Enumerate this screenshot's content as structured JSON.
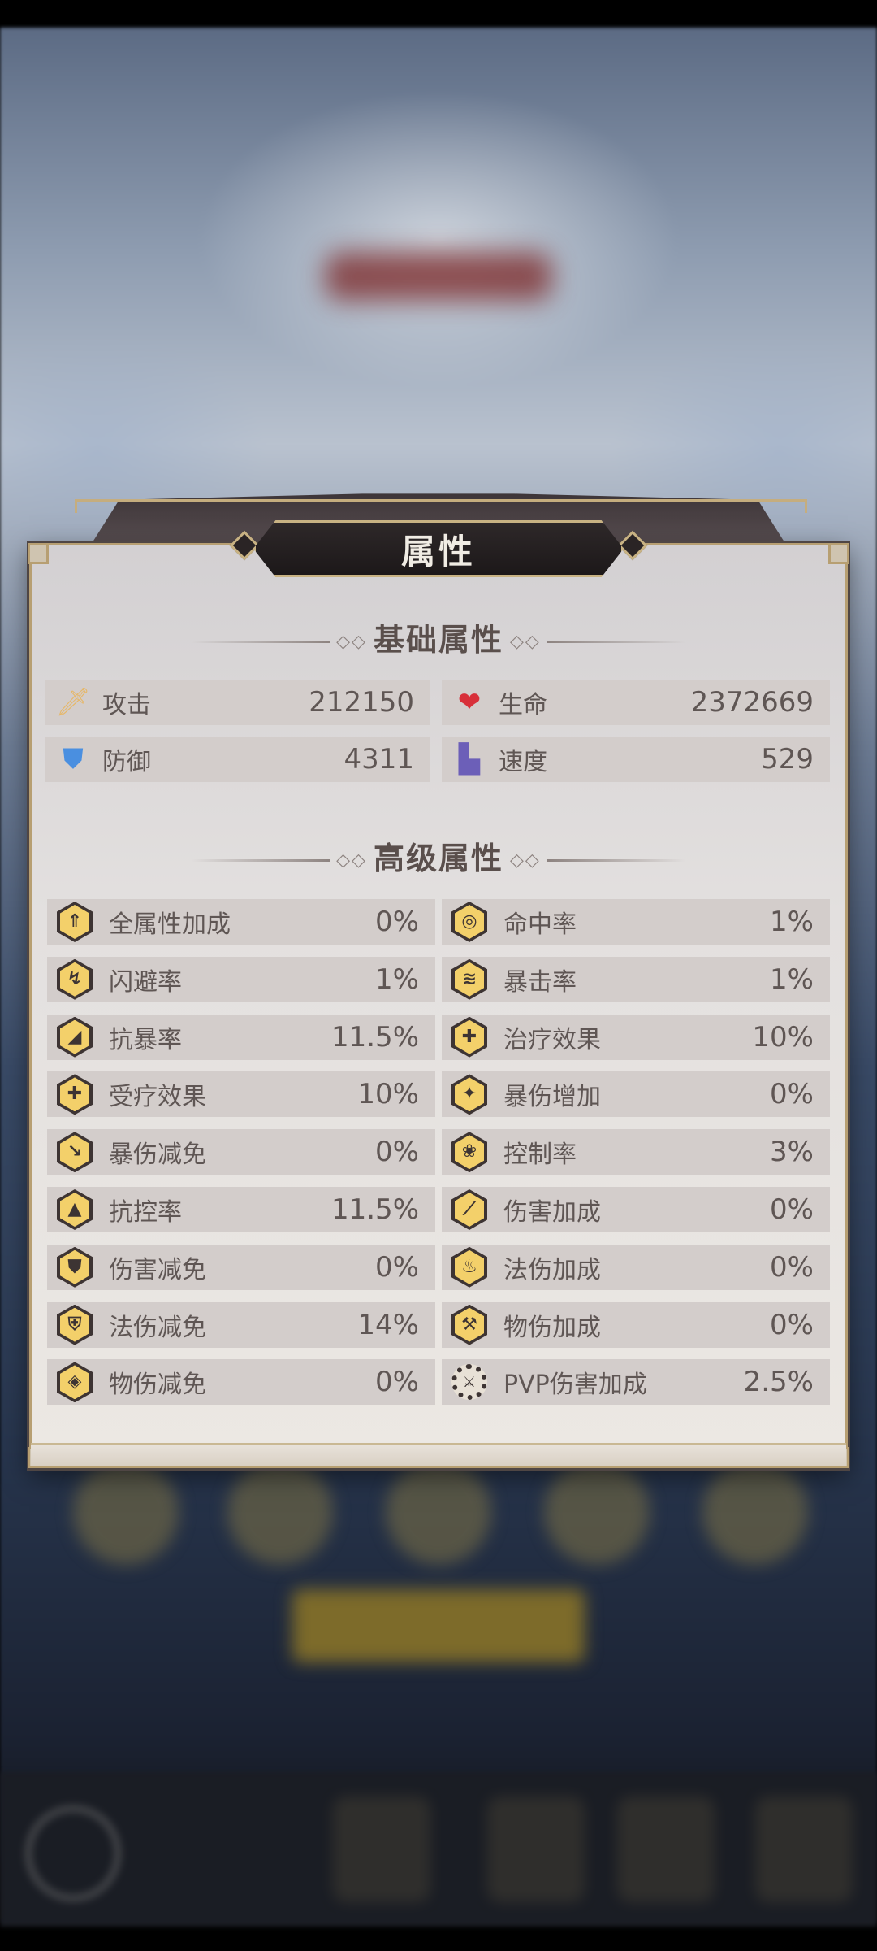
{
  "panel": {
    "title": "属性",
    "basic_section": "基础属性",
    "advanced_section": "高级属性"
  },
  "basic_stats": [
    {
      "label": "攻击",
      "value": "212150",
      "icon": "sword-icon"
    },
    {
      "label": "生命",
      "value": "2372669",
      "icon": "heart-icon"
    },
    {
      "label": "防御",
      "value": "4311",
      "icon": "shield-icon"
    },
    {
      "label": "速度",
      "value": "529",
      "icon": "boot-icon"
    }
  ],
  "advanced_stats": [
    {
      "label": "全属性加成",
      "value": "0%",
      "icon": "all-attributes-icon"
    },
    {
      "label": "命中率",
      "value": "1%",
      "icon": "target-icon"
    },
    {
      "label": "闪避率",
      "value": "1%",
      "icon": "dodge-icon"
    },
    {
      "label": "暴击率",
      "value": "1%",
      "icon": "claw-icon"
    },
    {
      "label": "抗暴率",
      "value": "11.5%",
      "icon": "crit-resist-icon"
    },
    {
      "label": "治疗效果",
      "value": "10%",
      "icon": "cross-icon"
    },
    {
      "label": "受疗效果",
      "value": "10%",
      "icon": "heal-received-icon"
    },
    {
      "label": "暴伤增加",
      "value": "0%",
      "icon": "crit-damage-icon"
    },
    {
      "label": "暴伤减免",
      "value": "0%",
      "icon": "crit-damage-reduction-icon"
    },
    {
      "label": "控制率",
      "value": "3%",
      "icon": "control-icon"
    },
    {
      "label": "抗控率",
      "value": "11.5%",
      "icon": "control-resist-icon"
    },
    {
      "label": "伤害加成",
      "value": "0%",
      "icon": "damage-bonus-icon"
    },
    {
      "label": "伤害减免",
      "value": "0%",
      "icon": "damage-reduction-icon"
    },
    {
      "label": "法伤加成",
      "value": "0%",
      "icon": "flame-icon"
    },
    {
      "label": "法伤减免",
      "value": "14%",
      "icon": "magic-shield-icon"
    },
    {
      "label": "物伤加成",
      "value": "0%",
      "icon": "hammer-icon"
    },
    {
      "label": "物伤减免",
      "value": "0%",
      "icon": "physical-shield-icon"
    },
    {
      "label": "PVP伤害加成",
      "value": "2.5%",
      "icon": "pvp-gear-icon"
    }
  ],
  "colors": {
    "panel_bg": "#e3e0df",
    "row_bg": "#d3cdcb",
    "icon_gold": "#f3d06a",
    "frame_gold": "#b79f72"
  }
}
